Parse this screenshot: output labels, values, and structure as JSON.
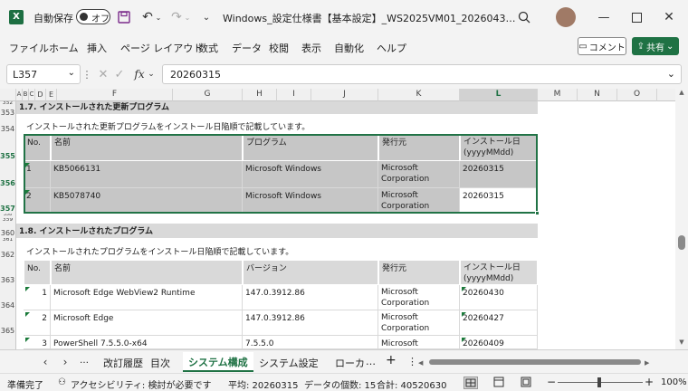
{
  "titlebar": {
    "autosave_label": "自動保存",
    "autosave_state": "オフ",
    "doc_title": "Windows_設定仕様書【基本設定】_WS2025VM01_2026043…",
    "icons": [
      "excel-logo",
      "save-icon",
      "undo-icon",
      "redo-icon",
      "search-icon",
      "minimize-icon",
      "maximize-icon",
      "close-icon"
    ]
  },
  "menu": {
    "items": [
      "ファイル",
      "ホーム",
      "挿入",
      "ページ レイアウト",
      "数式",
      "データ",
      "校閲",
      "表示",
      "自動化",
      "ヘルプ"
    ],
    "comment_label": "コメント",
    "share_label": "共有"
  },
  "formula_bar": {
    "name_box": "L357",
    "formula": "20260315"
  },
  "columns": [
    "A",
    "B",
    "C",
    "D",
    "E",
    "F",
    "G",
    "H",
    "I",
    "J",
    "K",
    "L",
    "M",
    "N",
    "O"
  ],
  "rows": [
    "352",
    "353",
    "354",
    "355",
    "356",
    "357",
    "358",
    "359",
    "360",
    "361",
    "362",
    "363",
    "364",
    "365"
  ],
  "section1": {
    "title": "1.7. インストールされた更新プログラム",
    "desc": "インストールされた更新プログラムをインストール日陥順で記載しています。",
    "headers": [
      "No.",
      "名前",
      "プログラム",
      "発行元",
      "インストール日",
      "(yyyyMMdd)"
    ],
    "rows": [
      {
        "no": "1",
        "name": "KB5066131",
        "program": "Microsoft Windows",
        "pub1": "Microsoft",
        "pub2": "Corporation",
        "date": "20260315"
      },
      {
        "no": "2",
        "name": "KB5078740",
        "program": "Microsoft Windows",
        "pub1": "Microsoft",
        "pub2": "Corporation",
        "date": "20260315"
      }
    ]
  },
  "section2": {
    "title": "1.8. インストールされたプログラム",
    "desc": "インストールされたプログラムをインストール日陥順で記載しています。",
    "headers": [
      "No.",
      "名前",
      "バージョン",
      "発行元",
      "インストール日",
      "(yyyyMMdd)"
    ],
    "rows": [
      {
        "no": "1",
        "name": "Microsoft Edge WebView2 Runtime",
        "version": "147.0.3912.86",
        "pub1": "Microsoft",
        "pub2": "Corporation",
        "date": "20260430"
      },
      {
        "no": "2",
        "name": "Microsoft Edge",
        "version": "147.0.3912.86",
        "pub1": "Microsoft",
        "pub2": "Corporation",
        "date": "20260427"
      },
      {
        "no": "3",
        "name": "PowerShell 7.5.5.0-x64",
        "version": "7.5.5.0",
        "pub1": "Microsoft",
        "pub2": "",
        "date": "20260409"
      }
    ]
  },
  "sheet_tabs": {
    "tabs": [
      "改訂履歴",
      "目次",
      "システム構成",
      "システム設定",
      "ローカ"
    ],
    "active": "システム構成",
    "more": "…",
    "add": "+",
    "options": "⋮"
  },
  "status": {
    "ready": "準備完了",
    "accessibility": "アクセシビリティ: 検討が必要です",
    "average": "平均: 20260315",
    "count": "データの個数: 15",
    "sum": "合計: 40520630",
    "zoom": "100%",
    "zoom_level": 1.0
  },
  "colors": {
    "accent": "#1f7244",
    "header_fill": "#d9d9d9",
    "selection_border": "#217346"
  }
}
